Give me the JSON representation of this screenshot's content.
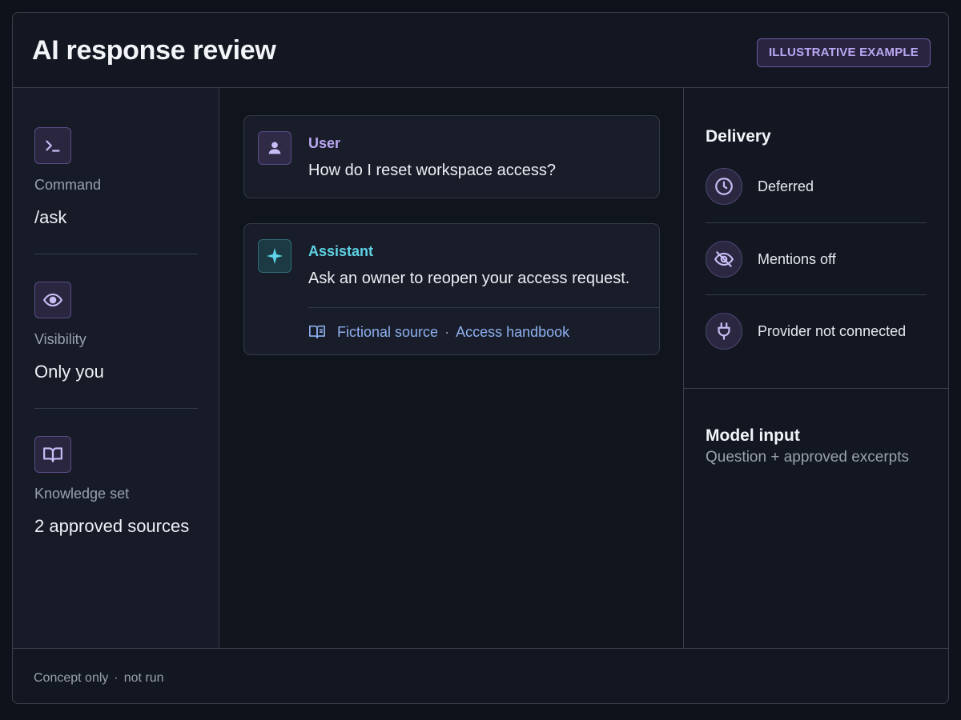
{
  "header": {
    "title": "AI response review",
    "badge": "ILLUSTRATIVE EXAMPLE"
  },
  "settings": [
    {
      "icon": "terminal-icon",
      "label": "Command",
      "value": "/ask"
    },
    {
      "icon": "eye-icon",
      "label": "Visibility",
      "value": "Only you"
    },
    {
      "icon": "book-icon",
      "label": "Knowledge set",
      "value": "2 approved sources"
    }
  ],
  "conversation": {
    "user": {
      "role": "User",
      "message": "How do I reset workspace access?"
    },
    "assistant": {
      "role": "Assistant",
      "message": "Ask an owner to reopen your access request.",
      "source_type": "Fictional source",
      "source_separator": "·",
      "source_name": "Access handbook"
    }
  },
  "delivery": {
    "title": "Delivery",
    "items": [
      {
        "icon": "clock-icon",
        "label": "Deferred"
      },
      {
        "icon": "eye-off-icon",
        "label": "Mentions off"
      },
      {
        "icon": "plug-icon",
        "label": "Provider not connected"
      }
    ]
  },
  "model_input": {
    "title": "Model input",
    "value": "Question + approved excerpts"
  },
  "footer": {
    "left": "Concept only",
    "separator": "·",
    "right": "not run"
  },
  "colors": {
    "accent_purple": "#b9a7f2",
    "assistant_teal": "#5fd3e6",
    "link_blue": "#8fb0f0",
    "background": "#0e121b"
  }
}
